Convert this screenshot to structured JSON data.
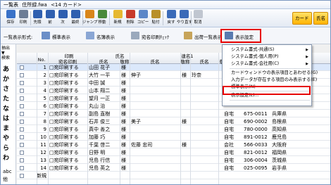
{
  "window": {
    "title_parts": [
      "一覧表",
      "住所録.fwa",
      "<14 カード>"
    ]
  },
  "header_buttons": {
    "card": "カード",
    "name": "氏名"
  },
  "toolbar": {
    "items": [
      {
        "label": "保存",
        "icon": "save-icon",
        "color": "#3a72c8"
      },
      {
        "label": "印刷",
        "icon": "print-icon",
        "color": "#6c7d96"
      },
      {
        "label": "先頭",
        "icon": "first-icon",
        "color": "#2f5fb0"
      },
      {
        "label": "前",
        "icon": "prev-icon",
        "color": "#2f5fb0"
      },
      {
        "label": "次",
        "icon": "next-icon",
        "color": "#2f5fb0"
      },
      {
        "label": "最終",
        "icon": "last-icon",
        "color": "#2f5fb0"
      },
      {
        "label": "ジャンプ",
        "icon": "jump-icon",
        "color": "#d9861a"
      },
      {
        "label": "移動",
        "icon": "move-icon",
        "color": "#4a8a3a"
      },
      {
        "label": "新規",
        "icon": "new-icon",
        "color": "#e6b830"
      },
      {
        "label": "削除",
        "icon": "delete-icon",
        "color": "#c83a2a"
      },
      {
        "label": "コピー",
        "icon": "copy-icon",
        "color": "#5a86c8"
      },
      {
        "label": "貼付",
        "icon": "paste-icon",
        "color": "#b8902a"
      },
      {
        "label": "戻す",
        "icon": "undo-icon",
        "color": "#3a6ab8"
      },
      {
        "label": "やり直す",
        "icon": "redo-icon",
        "color": "#3a6ab8"
      },
      {
        "label": "取消",
        "icon": "cancel-icon",
        "color": "#c0c6d0"
      }
    ]
  },
  "subbar": {
    "list_format_label": "一覧表示形式:",
    "standard_display": "標準表示",
    "name_display": "名簿表示",
    "address_check": "宛名印刷ﾁｪｯｸ",
    "shipping_display": "出荷一覧表示",
    "display_settings": "表示設定"
  },
  "left_panel": {
    "title_line1": "抽出",
    "title_line2": "▼",
    "title_line3": "検索",
    "kana": [
      "あ",
      "か",
      "さ",
      "た",
      "な",
      "は",
      "ま",
      "や",
      "ら",
      "わ"
    ],
    "extra": [
      "abc",
      "他"
    ]
  },
  "grid": {
    "group_headers": {
      "print": "印刷",
      "name": "氏名",
      "joint_name": "連名1"
    },
    "col_no": "No.",
    "col_print_target": "宛名印刷",
    "col_name": "氏名",
    "col_honorific": "敬称",
    "col_name2": "氏名",
    "col_honorific2": "敬称",
    "col_name3": "氏名",
    "col_honorific3": "敬",
    "rows": [
      {
        "no": "1",
        "print": "□宛印刷する",
        "name": "山田 花子",
        "hon": "様",
        "name2": "",
        "hon2": "",
        "name3": "",
        "addr": "",
        "zip": "",
        "pref": ""
      },
      {
        "no": "2",
        "print": "□宛印刷する",
        "name": "大竹 一平",
        "hon": "様",
        "name2": "伸子",
        "hon2": "様",
        "name3": "玲奈",
        "addr": "",
        "zip": "",
        "pref": ""
      },
      {
        "no": "3",
        "print": "□宛印刷する",
        "name": "中田 誠",
        "hon": "様",
        "name2": "",
        "hon2": "",
        "name3": "",
        "addr": "",
        "zip": "",
        "pref": ""
      },
      {
        "no": "4",
        "print": "□宛印刷する",
        "name": "山本 翔二",
        "hon": "様",
        "name2": "",
        "hon2": "",
        "name3": "",
        "addr": "",
        "zip": "",
        "pref": ""
      },
      {
        "no": "5",
        "print": "□宛印刷する",
        "name": "望月 一正",
        "hon": "様",
        "name2": "",
        "hon2": "",
        "name3": "",
        "addr": "",
        "zip": "",
        "pref": ""
      },
      {
        "no": "6",
        "print": "□宛印刷する",
        "name": "丸山 治",
        "hon": "様",
        "name2": "",
        "hon2": "",
        "name3": "",
        "addr": "",
        "zip": "",
        "pref": ""
      },
      {
        "no": "7",
        "print": "□宛印刷する",
        "name": "副島 直樹",
        "hon": "様",
        "name2": "",
        "hon2": "",
        "name3": "",
        "addr": "自宅",
        "zip": "675-0011",
        "pref": "兵庫県"
      },
      {
        "no": "8",
        "print": "□宛印刷する",
        "name": "石井 俊三",
        "hon": "様",
        "name2": "美子",
        "hon2": "様",
        "name3": "",
        "addr": "自宅",
        "zip": "690-0002",
        "pref": "島根県"
      },
      {
        "no": "9",
        "print": "□宛印刷する",
        "name": "真中 善之",
        "hon": "様",
        "name2": "",
        "hon2": "",
        "name3": "",
        "addr": "自宅",
        "zip": "780-0000",
        "pref": "高知県"
      },
      {
        "no": "10",
        "print": "□宛印刷する",
        "name": "加藤 巧",
        "hon": "様",
        "name2": "",
        "hon2": "",
        "name3": "",
        "addr": "自宅",
        "zip": "891-0012",
        "pref": "鹿児島"
      },
      {
        "no": "11",
        "print": "□宛印刷する",
        "name": "千葉 啓二",
        "hon": "様",
        "name2": "佐藤 忠司",
        "hon2": "様",
        "name3": "",
        "addr": "会社",
        "zip": "566-0033",
        "pref": "大阪府"
      },
      {
        "no": "12",
        "print": "□宛印刷する",
        "name": "日野 明",
        "hon": "様",
        "name2": "",
        "hon2": "",
        "name3": "",
        "addr": "自宅",
        "zip": "821-0012",
        "pref": "福岡県"
      },
      {
        "no": "13",
        "print": "□宛印刷する",
        "name": "児島 行信",
        "hon": "様",
        "name2": "",
        "hon2": "",
        "name3": "",
        "addr": "自宅",
        "zip": "306-0004",
        "pref": "茨城県"
      },
      {
        "no": "14",
        "print": "□宛印刷する",
        "name": "児島 英之",
        "hon": "様",
        "name2": "",
        "hon2": "",
        "name3": "",
        "addr": "自宅",
        "zip": "025-0095",
        "pref": "岩手県"
      }
    ],
    "new_row_label": "新規"
  },
  "context_menu": {
    "items": [
      {
        "label": "システム書式-共通(S)",
        "submenu": true
      },
      {
        "label": "システム書式-個人用(P)",
        "submenu": true
      },
      {
        "label": "システム書式-会社用(C)",
        "submenu": true
      },
      {
        "label": "カードウィンドウの表示項目とあわせる(G)",
        "submenu": false
      },
      {
        "label": "入力データが存在する項目のみ表示する(E)",
        "submenu": false
      },
      {
        "label": "標準表示(N)",
        "submenu": false
      },
      {
        "label": "表示設定(L)...",
        "submenu": false
      }
    ]
  }
}
